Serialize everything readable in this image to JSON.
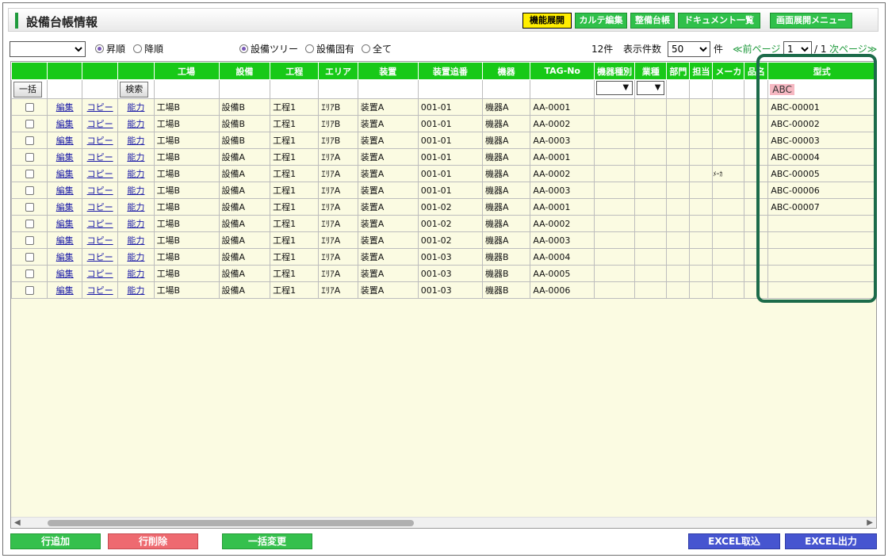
{
  "header": {
    "title": "設備台帳情報",
    "buttons": [
      "機能展開",
      "カルテ編集",
      "整備台帳",
      "ドキュメント一覧",
      "画面展開メニュー"
    ]
  },
  "controls": {
    "sort_asc": "昇順",
    "sort_desc": "降順",
    "scope": [
      "設備ツリー",
      "設備固有",
      "全て"
    ],
    "count": "12件",
    "per_page_label": "表示件数",
    "per_page": "50",
    "unit": "件",
    "prev": "≪前ページ",
    "page": "1",
    "total_pages": "/ 1",
    "next": "次ページ≫"
  },
  "columns": [
    "",
    "",
    "",
    "",
    "工場",
    "設備",
    "工程",
    "エリア",
    "装置",
    "装置追番",
    "機器",
    "TAG-No",
    "機器種別",
    "業種",
    "部門",
    "担当",
    "メーカ",
    "品名",
    "型式"
  ],
  "filter": {
    "bulk": "一括",
    "search": "検索",
    "model_value": "ABC"
  },
  "row_links": {
    "edit": "編集",
    "copy": "コピー",
    "capacity": "能力"
  },
  "rows": [
    {
      "factory": "工場B",
      "equipment": "設備B",
      "process": "工程1",
      "area": "ｴﾘｱB",
      "device": "装置A",
      "device_no": "001-01",
      "machine": "機器A",
      "tag": "AA-0001",
      "maker": "",
      "model": "ABC-00001"
    },
    {
      "factory": "工場B",
      "equipment": "設備B",
      "process": "工程1",
      "area": "ｴﾘｱB",
      "device": "装置A",
      "device_no": "001-01",
      "machine": "機器A",
      "tag": "AA-0002",
      "maker": "",
      "model": "ABC-00002"
    },
    {
      "factory": "工場B",
      "equipment": "設備B",
      "process": "工程1",
      "area": "ｴﾘｱB",
      "device": "装置A",
      "device_no": "001-01",
      "machine": "機器A",
      "tag": "AA-0003",
      "maker": "",
      "model": "ABC-00003"
    },
    {
      "factory": "工場B",
      "equipment": "設備A",
      "process": "工程1",
      "area": "ｴﾘｱA",
      "device": "装置A",
      "device_no": "001-01",
      "machine": "機器A",
      "tag": "AA-0001",
      "maker": "",
      "model": "ABC-00004"
    },
    {
      "factory": "工場B",
      "equipment": "設備A",
      "process": "工程1",
      "area": "ｴﾘｱA",
      "device": "装置A",
      "device_no": "001-01",
      "machine": "機器A",
      "tag": "AA-0002",
      "maker": "ﾒｰｶ",
      "model": "ABC-00005"
    },
    {
      "factory": "工場B",
      "equipment": "設備A",
      "process": "工程1",
      "area": "ｴﾘｱA",
      "device": "装置A",
      "device_no": "001-01",
      "machine": "機器A",
      "tag": "AA-0003",
      "maker": "",
      "model": "ABC-00006"
    },
    {
      "factory": "工場B",
      "equipment": "設備A",
      "process": "工程1",
      "area": "ｴﾘｱA",
      "device": "装置A",
      "device_no": "001-02",
      "machine": "機器A",
      "tag": "AA-0001",
      "maker": "",
      "model": "ABC-00007"
    },
    {
      "factory": "工場B",
      "equipment": "設備A",
      "process": "工程1",
      "area": "ｴﾘｱA",
      "device": "装置A",
      "device_no": "001-02",
      "machine": "機器A",
      "tag": "AA-0002",
      "maker": "",
      "model": ""
    },
    {
      "factory": "工場B",
      "equipment": "設備A",
      "process": "工程1",
      "area": "ｴﾘｱA",
      "device": "装置A",
      "device_no": "001-02",
      "machine": "機器A",
      "tag": "AA-0003",
      "maker": "",
      "model": ""
    },
    {
      "factory": "工場B",
      "equipment": "設備A",
      "process": "工程1",
      "area": "ｴﾘｱA",
      "device": "装置A",
      "device_no": "001-03",
      "machine": "機器B",
      "tag": "AA-0004",
      "maker": "",
      "model": ""
    },
    {
      "factory": "工場B",
      "equipment": "設備A",
      "process": "工程1",
      "area": "ｴﾘｱA",
      "device": "装置A",
      "device_no": "001-03",
      "machine": "機器B",
      "tag": "AA-0005",
      "maker": "",
      "model": ""
    },
    {
      "factory": "工場B",
      "equipment": "設備A",
      "process": "工程1",
      "area": "ｴﾘｱA",
      "device": "装置A",
      "device_no": "001-03",
      "machine": "機器B",
      "tag": "AA-0006",
      "maker": "",
      "model": ""
    }
  ],
  "footer": {
    "add_row": "行追加",
    "delete_row": "行削除",
    "bulk_change": "一括変更",
    "excel_import": "EXCEL取込",
    "excel_export": "EXCEL出力"
  },
  "colors": {
    "accent": "#18c918",
    "highlight": "#1c6b4a"
  }
}
